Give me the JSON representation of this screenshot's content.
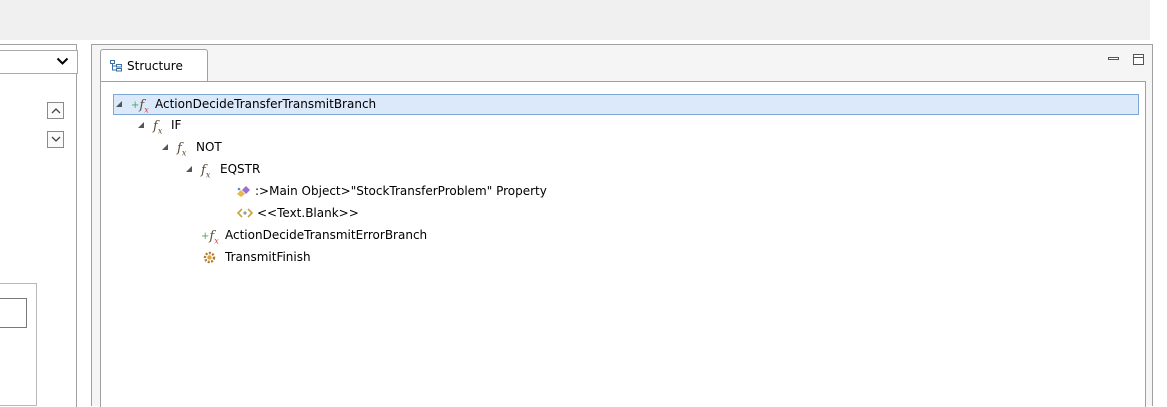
{
  "view": {
    "tab_label": "Structure"
  },
  "tree": [
    {
      "label": "ActionDecideTransferTransmitBranch",
      "icon": "action-function-icon",
      "depth": 0,
      "expanded": true,
      "selected": true
    },
    {
      "label": "IF",
      "icon": "function-icon",
      "depth": 1,
      "expanded": true
    },
    {
      "label": "NOT",
      "icon": "function-icon",
      "depth": 2,
      "expanded": true
    },
    {
      "label": "EQSTR",
      "icon": "function-icon",
      "depth": 3,
      "expanded": true
    },
    {
      "label": ":>Main Object>\"StockTransferProblem\" Property",
      "icon": "property-icon",
      "depth": 4
    },
    {
      "label": "<<Text.Blank>>",
      "icon": "constant-icon",
      "depth": 4
    },
    {
      "label": "ActionDecideTransmitErrorBranch",
      "icon": "action-function-icon",
      "depth": 1
    },
    {
      "label": "TransmitFinish",
      "icon": "gear-icon",
      "depth": 1
    }
  ]
}
